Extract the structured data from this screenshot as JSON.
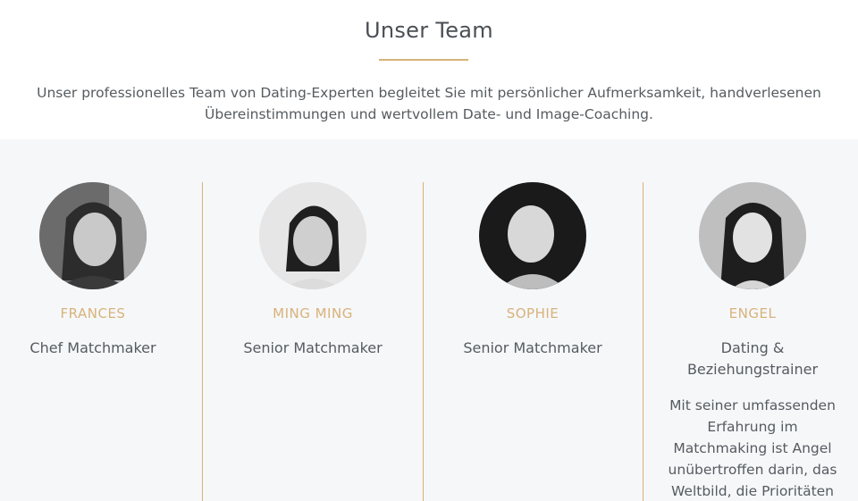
{
  "header": {
    "title": "Unser Team",
    "intro": "Unser professionelles Team von Dating-Experten begleitet Sie mit persönlicher Aufmerksamkeit, handverlesenen Übereinstimmungen und wertvollem Date- und Image-Coaching."
  },
  "colors": {
    "accent": "#d7b37a",
    "section_bg": "#f6f7f9",
    "text": "#555b60"
  },
  "team": [
    {
      "name": "FRANCES",
      "role": "Chef Matchmaker",
      "bio": ""
    },
    {
      "name": "MING MING",
      "role": "Senior Matchmaker",
      "bio": ""
    },
    {
      "name": "SOPHIE",
      "role": "Senior Matchmaker",
      "bio": ""
    },
    {
      "name": "ENGEL",
      "role": "Dating & Beziehungstrainer",
      "bio": "Mit seiner umfassenden Erfahrung im Matchmaking ist Angel unübertroffen darin, das Weltbild, die Prioritäten"
    }
  ]
}
